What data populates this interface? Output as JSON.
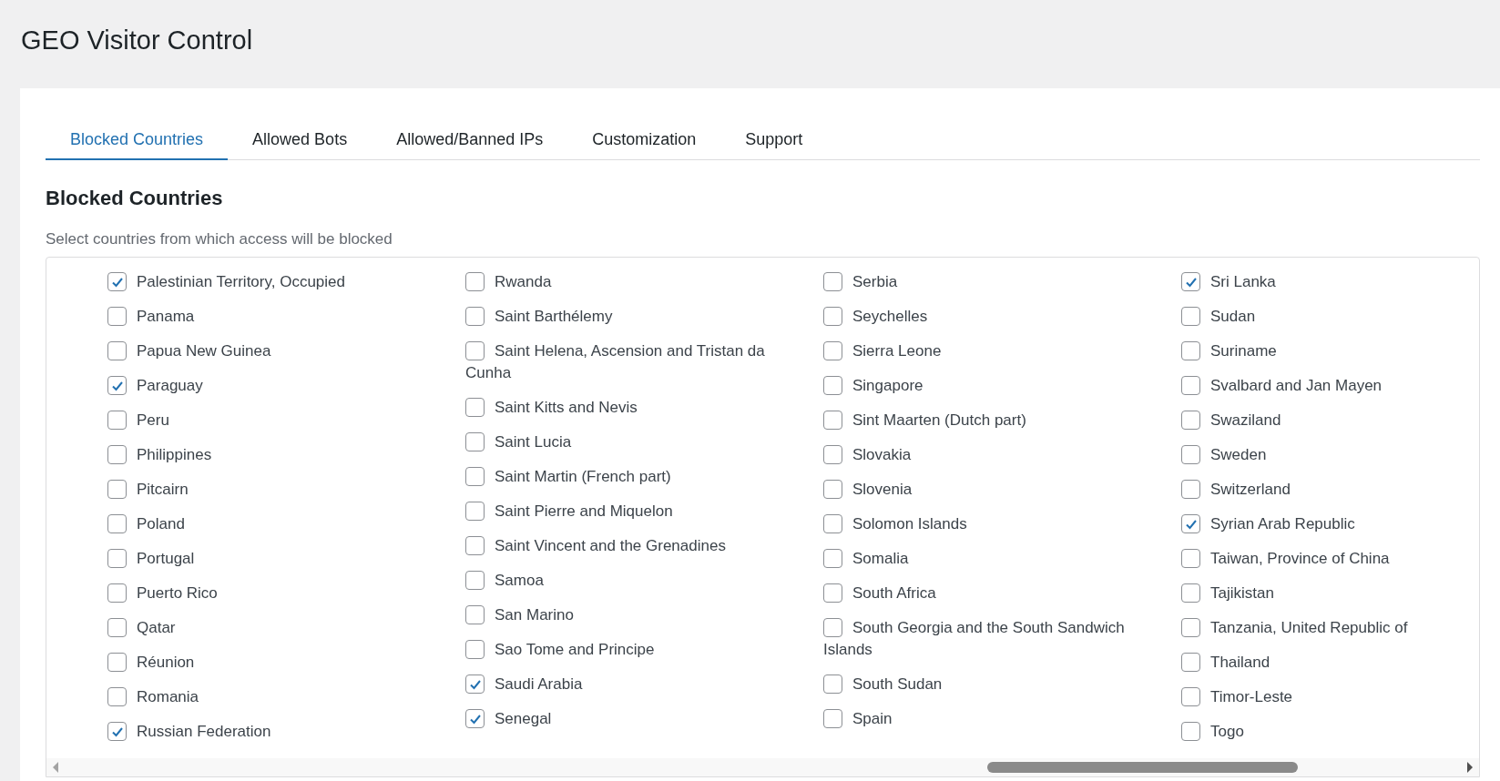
{
  "page_title": "GEO Visitor Control",
  "tabs": [
    {
      "label": "Blocked Countries",
      "selected": true
    },
    {
      "label": "Allowed Bots",
      "selected": false
    },
    {
      "label": "Allowed/Banned IPs",
      "selected": false
    },
    {
      "label": "Customization",
      "selected": false
    },
    {
      "label": "Support",
      "selected": false
    }
  ],
  "section": {
    "heading": "Blocked Countries",
    "description": "Select countries from which access will be blocked"
  },
  "country_columns": [
    [
      {
        "name": "Palestinian Territory, Occupied",
        "checked": true
      },
      {
        "name": "Panama",
        "checked": false
      },
      {
        "name": "Papua New Guinea",
        "checked": false
      },
      {
        "name": "Paraguay",
        "checked": true
      },
      {
        "name": "Peru",
        "checked": false
      },
      {
        "name": "Philippines",
        "checked": false
      },
      {
        "name": "Pitcairn",
        "checked": false
      },
      {
        "name": "Poland",
        "checked": false
      },
      {
        "name": "Portugal",
        "checked": false
      },
      {
        "name": "Puerto Rico",
        "checked": false
      },
      {
        "name": "Qatar",
        "checked": false
      },
      {
        "name": "Réunion",
        "checked": false
      },
      {
        "name": "Romania",
        "checked": false
      },
      {
        "name": "Russian Federation",
        "checked": true
      }
    ],
    [
      {
        "name": "Rwanda",
        "checked": false
      },
      {
        "name": "Saint Barthélemy",
        "checked": false
      },
      {
        "name": "Saint Helena, Ascension and Tristan da Cunha",
        "checked": false
      },
      {
        "name": "Saint Kitts and Nevis",
        "checked": false
      },
      {
        "name": "Saint Lucia",
        "checked": false
      },
      {
        "name": "Saint Martin (French part)",
        "checked": false
      },
      {
        "name": "Saint Pierre and Miquelon",
        "checked": false
      },
      {
        "name": "Saint Vincent and the Grenadines",
        "checked": false
      },
      {
        "name": "Samoa",
        "checked": false
      },
      {
        "name": "San Marino",
        "checked": false
      },
      {
        "name": "Sao Tome and Principe",
        "checked": false
      },
      {
        "name": "Saudi Arabia",
        "checked": true
      },
      {
        "name": "Senegal",
        "checked": true
      }
    ],
    [
      {
        "name": "Serbia",
        "checked": false
      },
      {
        "name": "Seychelles",
        "checked": false
      },
      {
        "name": "Sierra Leone",
        "checked": false
      },
      {
        "name": "Singapore",
        "checked": false
      },
      {
        "name": "Sint Maarten (Dutch part)",
        "checked": false
      },
      {
        "name": "Slovakia",
        "checked": false
      },
      {
        "name": "Slovenia",
        "checked": false
      },
      {
        "name": "Solomon Islands",
        "checked": false
      },
      {
        "name": "Somalia",
        "checked": false
      },
      {
        "name": "South Africa",
        "checked": false
      },
      {
        "name": "South Georgia and the South Sandwich Islands",
        "checked": false
      },
      {
        "name": "South Sudan",
        "checked": false
      },
      {
        "name": "Spain",
        "checked": false
      }
    ],
    [
      {
        "name": "Sri Lanka",
        "checked": true
      },
      {
        "name": "Sudan",
        "checked": false
      },
      {
        "name": "Suriname",
        "checked": false
      },
      {
        "name": "Svalbard and Jan Mayen",
        "checked": false
      },
      {
        "name": "Swaziland",
        "checked": false
      },
      {
        "name": "Sweden",
        "checked": false
      },
      {
        "name": "Switzerland",
        "checked": false
      },
      {
        "name": "Syrian Arab Republic",
        "checked": true
      },
      {
        "name": "Taiwan, Province of China",
        "checked": false
      },
      {
        "name": "Tajikistan",
        "checked": false
      },
      {
        "name": "Tanzania, United Republic of",
        "checked": false
      },
      {
        "name": "Thailand",
        "checked": false
      },
      {
        "name": "Timor-Leste",
        "checked": false
      },
      {
        "name": "Togo",
        "checked": false
      }
    ]
  ]
}
